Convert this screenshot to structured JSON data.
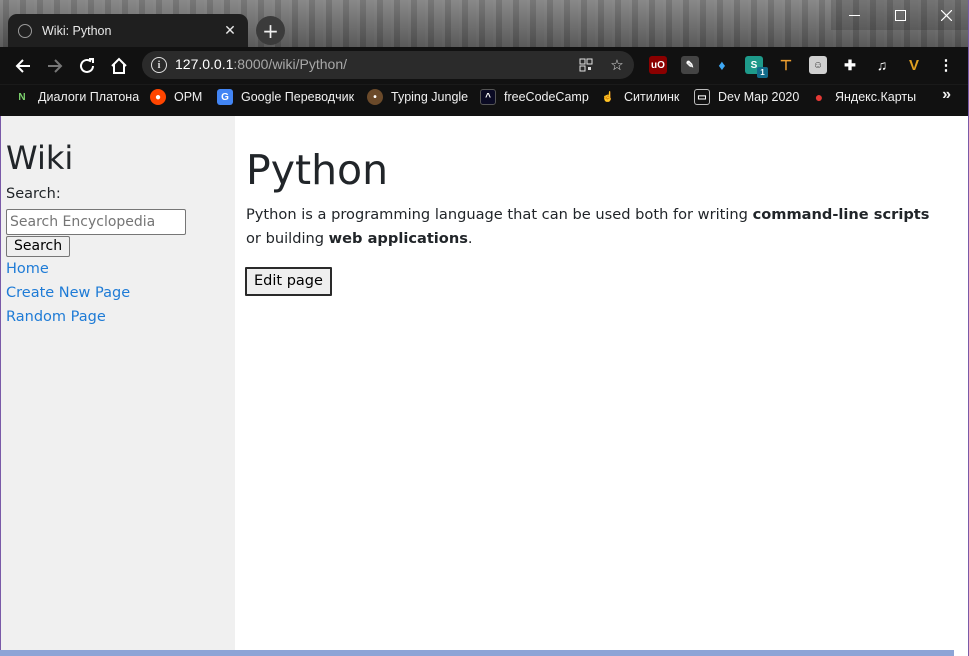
{
  "browser": {
    "tab_title": "Wiki: Python",
    "tab_close": "✕",
    "new_tab": "+",
    "url_host": "127.0.0.1",
    "url_rest": ":8000/wiki/Python/",
    "bookmarks": [
      {
        "label": "Диалоги Платона",
        "icon": "n-logo-icon",
        "color": "#1b1b1b"
      },
      {
        "label": "ОРМ",
        "icon": "reddit-icon",
        "color": "#ff4500"
      },
      {
        "label": "Google Переводчик",
        "icon": "google-translate-icon",
        "color": "#4285f4"
      },
      {
        "label": "Typing Jungle",
        "icon": "typing-jungle-icon",
        "color": "#6b4a2a"
      },
      {
        "label": "freeCodeCamp",
        "icon": "freecodecamp-icon",
        "color": "#0a0a23"
      },
      {
        "label": "Ситилинк",
        "icon": "citilink-icon",
        "color": "#f57c00"
      },
      {
        "label": "Dev Map 2020",
        "icon": "devmap-icon",
        "color": "#333333"
      },
      {
        "label": "Яндекс.Карты",
        "icon": "map-pin-icon",
        "color": "#e53935"
      }
    ],
    "more_bookmarks": "»",
    "extension_badge": "1"
  },
  "sidebar": {
    "title": "Wiki",
    "search_label": "Search:",
    "search_placeholder": "Search Encyclopedia",
    "search_button": "Search",
    "links": [
      "Home",
      "Create New Page",
      "Random Page"
    ],
    "link_color": "#1e7bd6"
  },
  "main": {
    "title": "Python",
    "text_1": "Python is a programming language that can be used both for writing ",
    "bold_1": "command-line scripts",
    "text_2": " or building ",
    "bold_2": "web applications",
    "text_3": ".",
    "edit_button": "Edit page"
  }
}
